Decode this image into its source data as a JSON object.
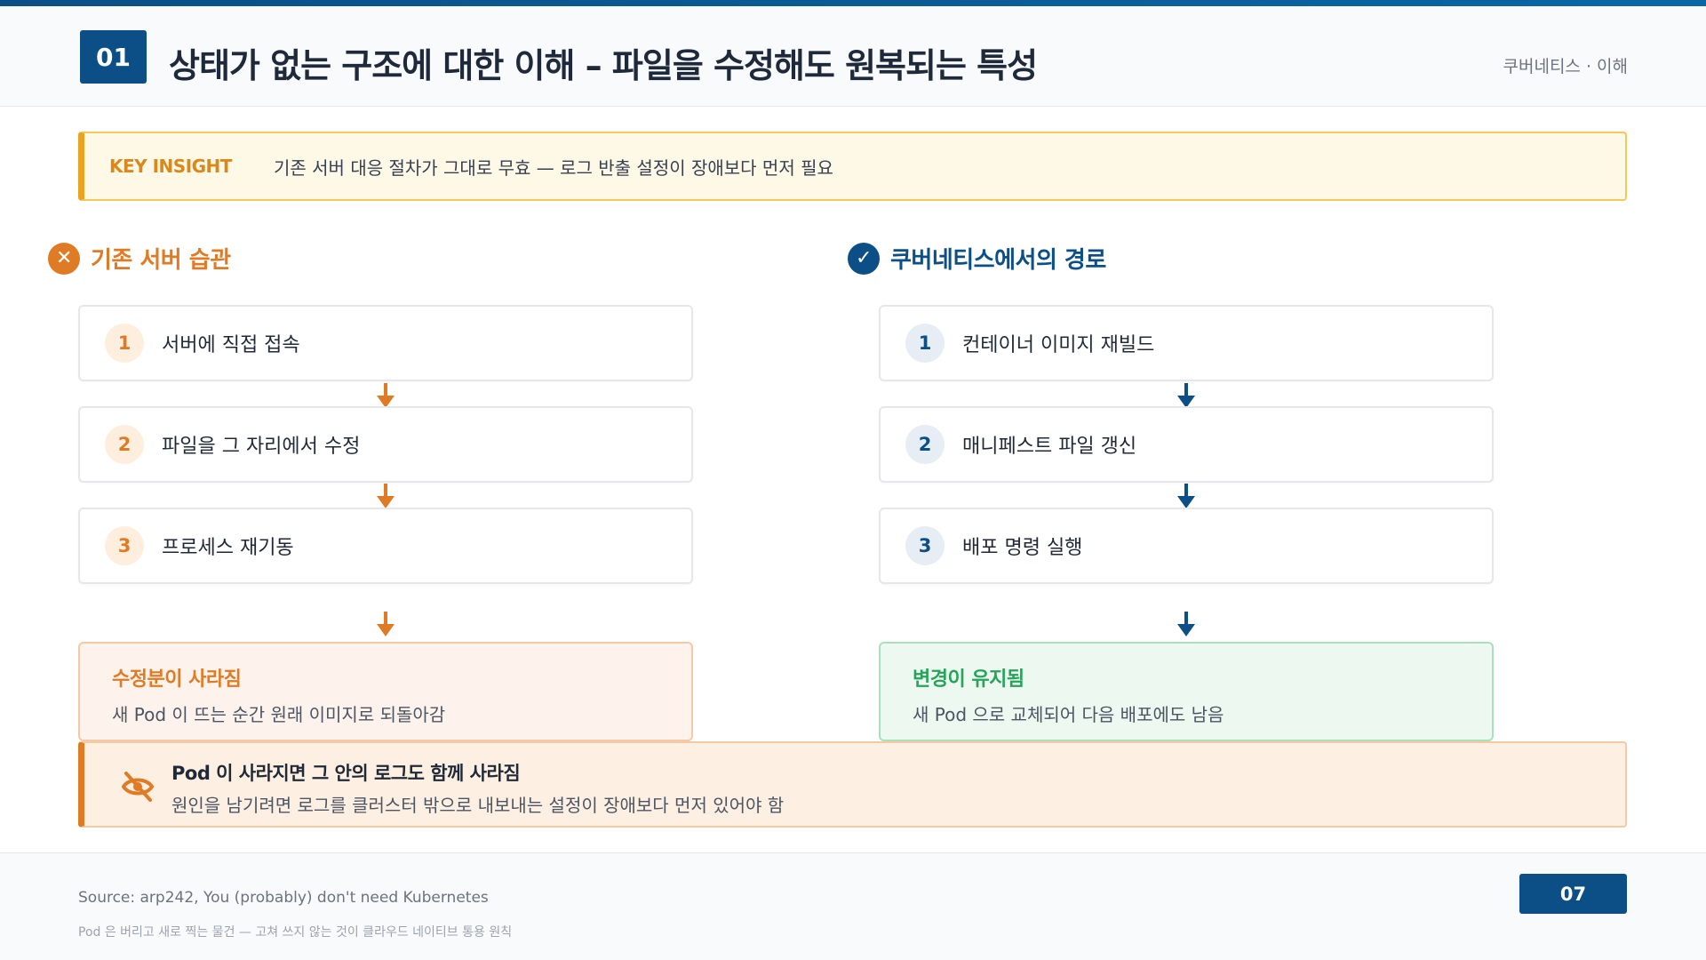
{
  "header": {
    "number": "01",
    "title": "상태가 없는 구조에 대한 이해 – 파일을 수정해도 원복되는 특성",
    "breadcrumb": "쿠버네티스 · 이해"
  },
  "insight": {
    "label": "KEY INSIGHT",
    "text": "기존 서버 대응 절차가 그대로 무효 — 로그 반출 설정이 장애보다 먼저 필요"
  },
  "left": {
    "heading": "기존 서버 습관",
    "icon": "x-circle-icon",
    "steps": [
      {
        "num": "1",
        "label": "서버에 직접 접속"
      },
      {
        "num": "2",
        "label": "파일을 그 자리에서 수정"
      },
      {
        "num": "3",
        "label": "프로세스 재기동"
      }
    ],
    "result": {
      "title": "수정분이 사라짐",
      "desc": "새 Pod 이 뜨는 순간 원래 이미지로 되돌아감"
    }
  },
  "right": {
    "heading": "쿠버네티스에서의 경로",
    "icon": "check-circle-icon",
    "steps": [
      {
        "num": "1",
        "label": "컨테이너 이미지 재빌드"
      },
      {
        "num": "2",
        "label": "매니페스트 파일 갱신"
      },
      {
        "num": "3",
        "label": "배포 명령 실행"
      }
    ],
    "result": {
      "title": "변경이 유지됨",
      "desc": "새 Pod 으로 교체되어 다음 배포에도 남음"
    }
  },
  "warning": {
    "icon": "eye-off-icon",
    "title": "Pod 이 사라지면 그 안의 로그도 함께 사라짐",
    "desc": "원인을 남기려면 로그를 클러스터 밖으로 내보내는 설정이 장애보다 먼저 있어야 함"
  },
  "footer": {
    "source": "Source: arp242, You (probably) don't need Kubernetes",
    "note": "Pod 은 버리고 새로 찍는 물건 — 고쳐 쓰지 않는 것이 클라우드 네이티브 통용 원칙",
    "page": "07"
  },
  "colors": {
    "brand": "#0b4f86",
    "orange": "#e07b25",
    "green": "#27a35a",
    "insight_accent": "#eaa320"
  }
}
